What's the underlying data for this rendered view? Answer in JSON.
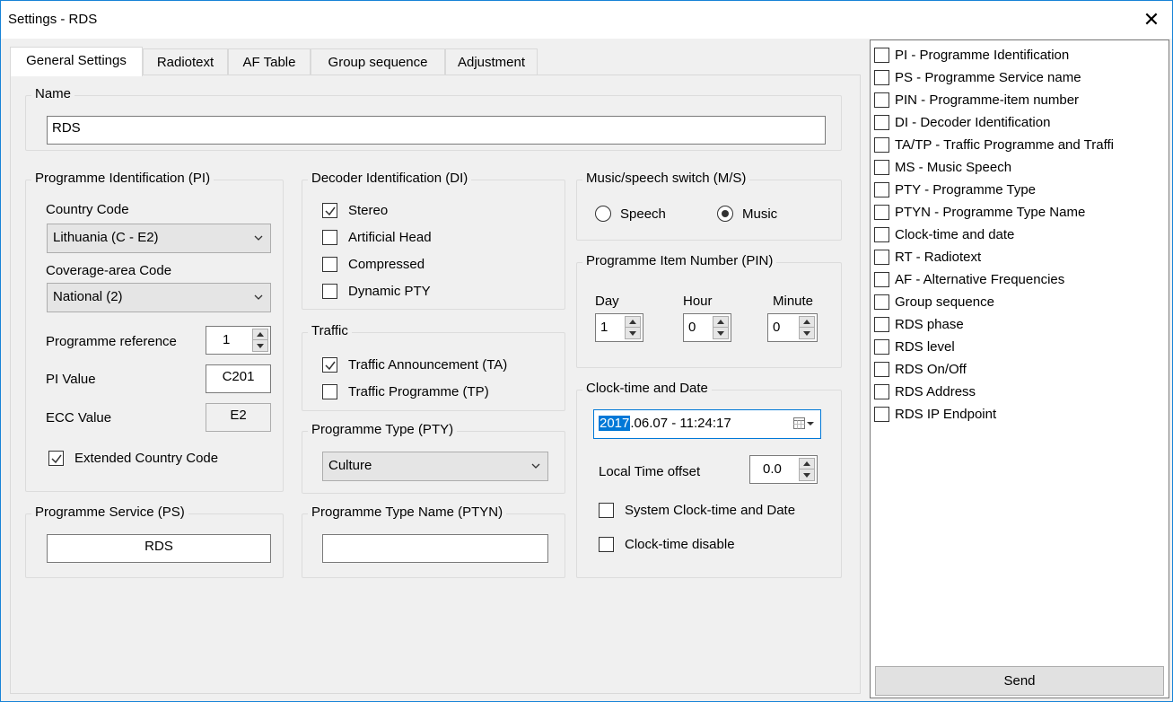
{
  "window": {
    "title": "Settings - RDS",
    "close_symbol": "✕"
  },
  "tabs": [
    {
      "label": "General Settings"
    },
    {
      "label": "Radiotext"
    },
    {
      "label": "AF Table"
    },
    {
      "label": "Group sequence"
    },
    {
      "label": "Adjustment"
    }
  ],
  "name_group": {
    "title": "Name",
    "value": "RDS"
  },
  "pi_group": {
    "title": "Programme Identification (PI)",
    "country_code_label": "Country Code",
    "country_code_value": "Lithuania (C - E2)",
    "coverage_label": "Coverage-area Code",
    "coverage_value": "National (2)",
    "programme_reference_label": "Programme reference",
    "programme_reference_value": "1",
    "pi_value_label": "PI Value",
    "pi_value": "C201",
    "ecc_label": "ECC Value",
    "ecc_value": "E2",
    "extended_country_code_label": "Extended Country Code",
    "extended_country_code_checked": true
  },
  "di_group": {
    "title": "Decoder Identification (DI)",
    "stereo": "Stereo",
    "artificial_head": "Artificial Head",
    "compressed": "Compressed",
    "dynamic_pty": "Dynamic PTY"
  },
  "ms_group": {
    "title": "Music/speech switch (M/S)",
    "speech": "Speech",
    "music": "Music",
    "selected": "music"
  },
  "pin_group": {
    "title": "Programme Item Number (PIN)",
    "day_label": "Day",
    "day_value": "1",
    "hour_label": "Hour",
    "hour_value": "0",
    "minute_label": "Minute",
    "minute_value": "0"
  },
  "traffic_group": {
    "title": "Traffic",
    "ta": "Traffic Announcement (TA)",
    "tp": "Traffic Programme (TP)"
  },
  "clock_group": {
    "title": "Clock-time and Date",
    "date_selected": "2017",
    "date_rest": ".06.07 - 11:24:17",
    "local_offset_label": "Local Time offset",
    "local_offset_value": "0.0",
    "system_clock": "System Clock-time and Date",
    "clock_disable": "Clock-time disable"
  },
  "pty_group": {
    "title": "Programme Type (PTY)",
    "value": "Culture"
  },
  "ps_group": {
    "title": "Programme Service (PS)",
    "value": "RDS"
  },
  "ptyn_group": {
    "title": "Programme Type Name (PTYN)",
    "value": ""
  },
  "rds_items": [
    {
      "label": "PI - Programme Identification"
    },
    {
      "label": "PS - Programme Service name"
    },
    {
      "label": "PIN - Programme-item number"
    },
    {
      "label": "DI - Decoder Identification"
    },
    {
      "label": "TA/TP - Traffic Programme and Traffi"
    },
    {
      "label": "MS - Music Speech"
    },
    {
      "label": "PTY - Programme Type"
    },
    {
      "label": "PTYN - Programme Type Name"
    },
    {
      "label": "Clock-time and date"
    },
    {
      "label": "RT - Radiotext"
    },
    {
      "label": "AF - Alternative Frequencies"
    },
    {
      "label": "Group sequence"
    },
    {
      "label": "RDS phase"
    },
    {
      "label": "RDS level"
    },
    {
      "label": "RDS On/Off"
    },
    {
      "label": "RDS Address"
    },
    {
      "label": "RDS IP Endpoint"
    }
  ],
  "send_label": "Send"
}
